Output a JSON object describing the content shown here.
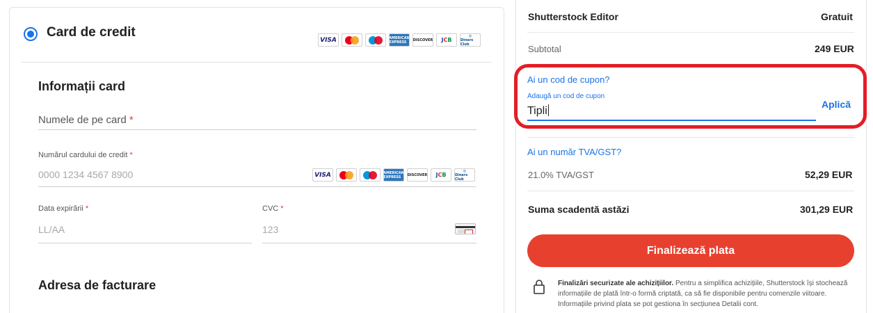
{
  "payment": {
    "method_label": "Card de credit",
    "brand_icons": [
      "visa-icon",
      "mastercard-icon",
      "maestro-icon",
      "amex-icon",
      "discover-icon",
      "jcb-icon",
      "diners-club-icon"
    ],
    "brand_text": {
      "visa": "VISA",
      "amex": "AMERICAN EXPRESS",
      "discover": "DISCOVER",
      "jcb": [
        "J",
        "C",
        "B"
      ],
      "diners": "Diners Club"
    }
  },
  "card_info": {
    "title": "Informații card",
    "name_placeholder": "Numele de pe card",
    "required_mark": "*",
    "number_label": "Numărul cardului de credit",
    "number_placeholder": "0000 1234 4567 8900",
    "expiry_label": "Data expirării",
    "expiry_placeholder": "LL/AA",
    "cvc_label": "CVC",
    "cvc_placeholder": "123"
  },
  "billing": {
    "title": "Adresa de facturare"
  },
  "summary": {
    "product_name": "Shutterstock Editor",
    "product_price": "Gratuit",
    "subtotal_label": "Subtotal",
    "subtotal_value": "249 EUR",
    "coupon_link": "Ai un cod de cupon?",
    "coupon_field_label": "Adaugă un cod de cupon",
    "coupon_value": "Tipli",
    "apply_label": "Aplică",
    "vat_link": "Ai un număr TVA/GST?",
    "vat_label": "21.0% TVA/GST",
    "vat_value": "52,29 EUR",
    "total_label": "Suma scadentă astăzi",
    "total_value": "301,29 EUR",
    "pay_button": "Finalizează plata",
    "secure_title": "Finalizări securizate ale achizițiilor.",
    "secure_text": "Pentru a simplifica achizițiile, Shutterstock își stochează informațiile de plată într-o formă criptată, ca să fie disponibile pentru comenzile viitoare. Informațiile privind plata se pot gestiona în secțiunea Detalii cont."
  },
  "colors": {
    "accent": "#1a73e8",
    "pay_button": "#e8402f",
    "highlight": "#e31e26"
  }
}
